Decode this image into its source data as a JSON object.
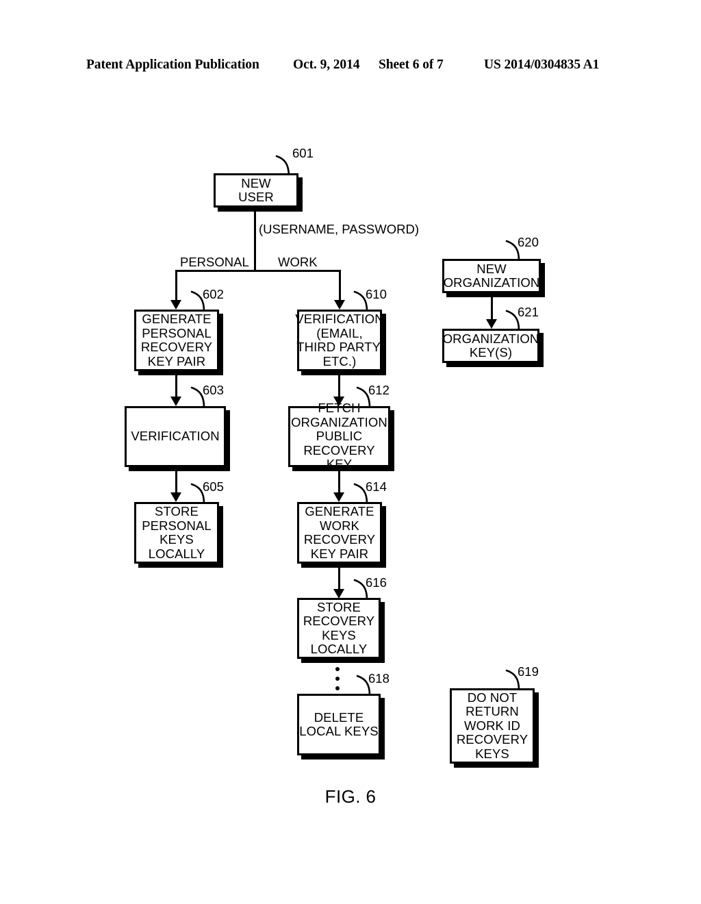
{
  "header": {
    "publication": "Patent Application Publication",
    "date": "Oct. 9, 2014",
    "sheet": "Sheet 6 of 7",
    "number": "US 2014/0304835 A1"
  },
  "figure": {
    "caption": "FIG. 6",
    "nodes": [
      {
        "ref": "601",
        "text": "NEW\nUSER"
      },
      {
        "ref": "602",
        "text": "GENERATE\nPERSONAL\nRECOVERY\nKEY PAIR"
      },
      {
        "ref": "603",
        "text": "VERIFICATION"
      },
      {
        "ref": "605",
        "text": "STORE\nPERSONAL\nKEYS\nLOCALLY"
      },
      {
        "ref": "610",
        "text": "VERIFICATION\n(EMAIL,\nTHIRD PARTY,\nETC.)"
      },
      {
        "ref": "612",
        "text": "FETCH\nORGANIZATION\nPUBLIC\nRECOVERY KEY"
      },
      {
        "ref": "614",
        "text": "GENERATE\nWORK\nRECOVERY\nKEY PAIR"
      },
      {
        "ref": "616",
        "text": "STORE\nRECOVERY\nKEYS\nLOCALLY"
      },
      {
        "ref": "618",
        "text": "DELETE\nLOCAL KEYS"
      },
      {
        "ref": "619",
        "text": "DO NOT\nRETURN\nWORK ID\nRECOVERY\nKEYS"
      },
      {
        "ref": "620",
        "text": "NEW\nORGANIZATION"
      },
      {
        "ref": "621",
        "text": "ORGANIZATION\nKEY(S)"
      }
    ],
    "edge_labels": {
      "credentials": "(USERNAME, PASSWORD)",
      "personal": "PERSONAL",
      "work": "WORK"
    }
  }
}
